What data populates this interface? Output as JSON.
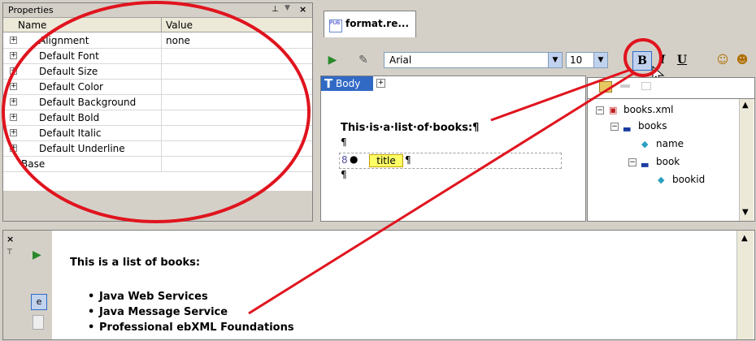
{
  "properties": {
    "title": "Properties",
    "pin_glyph": "↕",
    "close_glyph": "×",
    "col_name": "Name",
    "col_value": "Value",
    "rows": [
      {
        "name": "Alignment",
        "value": "none",
        "expandable": true
      },
      {
        "name": "Default Font",
        "value": "",
        "expandable": true
      },
      {
        "name": "Default Size",
        "value": "",
        "expandable": true
      },
      {
        "name": "Default Color",
        "value": "",
        "expandable": true
      },
      {
        "name": "Default Background",
        "value": "",
        "expandable": true
      },
      {
        "name": "Default Bold",
        "value": "",
        "expandable": true
      },
      {
        "name": "Default Italic",
        "value": "",
        "expandable": true
      },
      {
        "name": "Default Underline",
        "value": "",
        "expandable": true
      },
      {
        "name": "Base",
        "value": "",
        "expandable": false
      }
    ]
  },
  "editor": {
    "tab_label": "format.re...",
    "font_value": "Arial",
    "size_value": "10",
    "bold_label": "B",
    "italic_label": "I",
    "underline_label": "U",
    "body_tag_label": "Body",
    "design_text": "This·is·a·list·of·books:¶",
    "pilcrow": "¶",
    "title_tag": "title"
  },
  "tree": {
    "nodes": [
      {
        "label": "books.xml"
      },
      {
        "label": "books"
      },
      {
        "label": "name"
      },
      {
        "label": "book"
      },
      {
        "label": "bookid"
      }
    ]
  },
  "preview": {
    "heading": "This is a list of books:",
    "books": [
      "Java Web Services",
      "Java Message Service",
      "Professional ebXML Foundations"
    ]
  },
  "colors": {
    "annotation": "#e0141e",
    "selection": "#316ac5"
  }
}
